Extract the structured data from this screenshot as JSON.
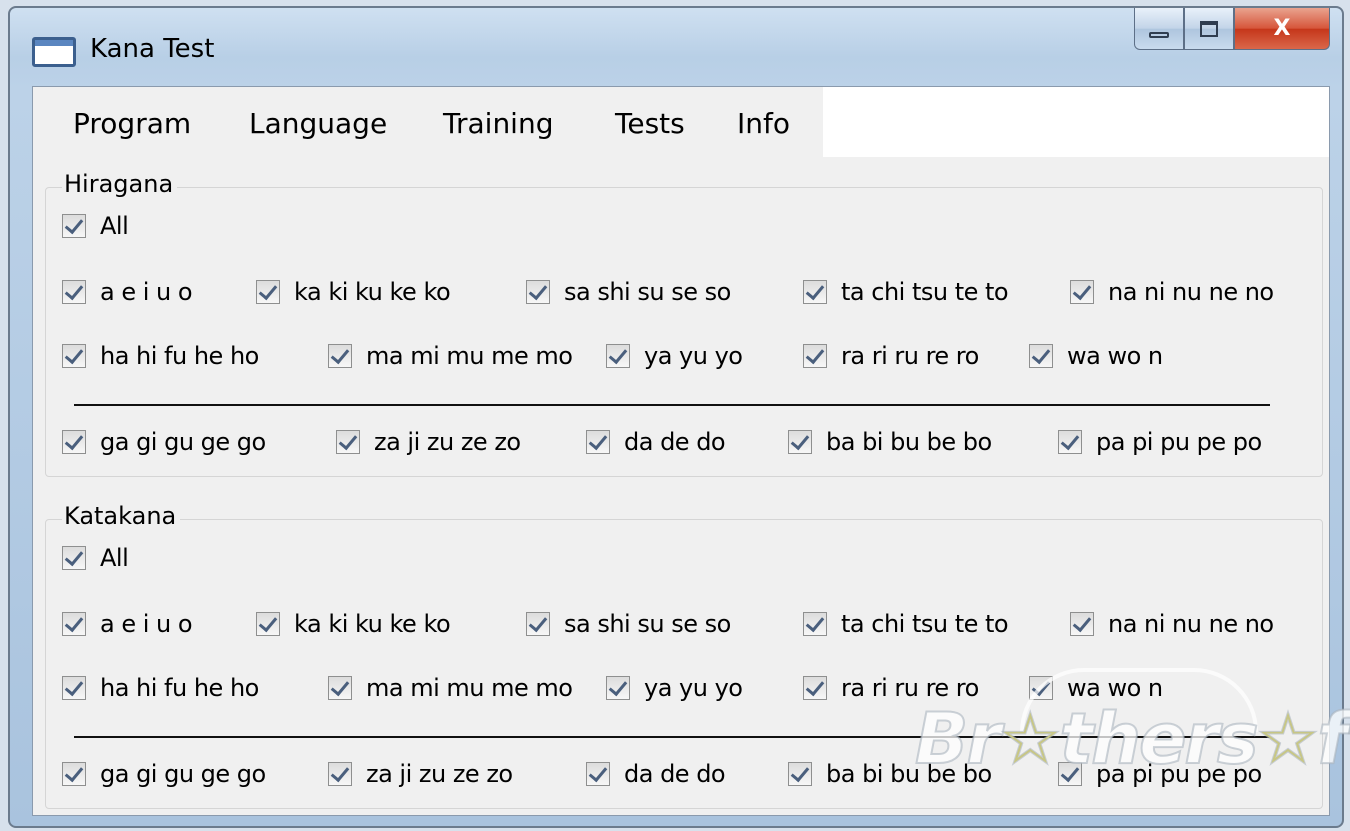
{
  "window": {
    "title": "Kana Test",
    "close_glyph": "X"
  },
  "menu": [
    "Program",
    "Language",
    "Training",
    "Tests",
    "Info"
  ],
  "groups": [
    {
      "legend": "Hiragana",
      "all_label": "All",
      "row1": [
        "a e i u o",
        "ka ki ku ke ko",
        "sa shi su se so",
        "ta chi tsu te to",
        "na ni nu ne no"
      ],
      "row2": [
        "ha hi fu he ho",
        "ma mi mu me mo",
        "ya yu yo",
        "ra ri ru re ro",
        "wa wo n"
      ],
      "row3": [
        "ga gi gu ge go",
        "za ji zu ze zo",
        "da de do",
        "ba bi bu be bo",
        "pa pi pu pe po"
      ]
    },
    {
      "legend": "Katakana",
      "all_label": "All",
      "row1": [
        "a e i u o",
        "ka ki ku ke ko",
        "sa shi su se so",
        "ta chi tsu te to",
        "na ni nu ne no"
      ],
      "row2": [
        "ha hi fu he ho",
        "ma mi mu me mo",
        "ya yu yo",
        "ra ri ru re ro",
        "wa wo n"
      ],
      "row3": [
        "ga gi gu ge go",
        "za ji zu ze zo",
        "da de do",
        "ba bi bu be bo",
        "pa pi pu pe po"
      ]
    }
  ],
  "all_checked": true,
  "watermark": {
    "part1": "Br",
    "star": "☆",
    "part2": "thers",
    "star2": "☆",
    "part3": "ft"
  },
  "icons": {
    "title": "window-icon",
    "check": "checkmark-icon"
  }
}
